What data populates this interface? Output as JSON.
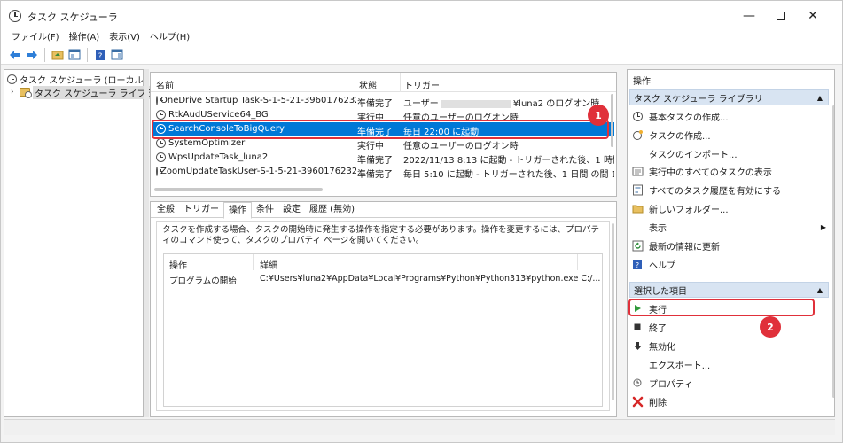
{
  "window": {
    "title": "タスク スケジューラ",
    "minimize": "—",
    "close": "✕"
  },
  "menu": [
    {
      "label": "ファイル(F)"
    },
    {
      "label": "操作(A)"
    },
    {
      "label": "表示(V)"
    },
    {
      "label": "ヘルプ(H)"
    }
  ],
  "tree": {
    "root": "タスク スケジューラ (ローカル)",
    "child": "タスク スケジューラ ライブラリ",
    "child_chevron": "›"
  },
  "task_list": {
    "columns": {
      "name": "名前",
      "status": "状態",
      "trigger": "トリガー"
    },
    "rows": [
      {
        "name": "OneDrive Startup Task-S-1-5-21-3960176232...",
        "status": "準備完了",
        "trigger_prefix": "ユーザー",
        "trigger": "¥luna2 のログオン時"
      },
      {
        "name": "RtkAudUService64_BG",
        "status": "実行中",
        "trigger": "任意のユーザーのログオン時"
      },
      {
        "name": "SearchConsoleToBigQuery",
        "status": "準備完了",
        "trigger": "毎日 22:00 に起動"
      },
      {
        "name": "SystemOptimizer",
        "status": "実行中",
        "trigger": "任意のユーザーのログオン時"
      },
      {
        "name": "WpsUpdateTask_luna2",
        "status": "準備完了",
        "trigger": "2022/11/13 8:13 に起動 - トリガーされた後、1 時間 ごと"
      },
      {
        "name": "ZoomUpdateTaskUser-S-1-5-21-3960176232...",
        "status": "準備完了",
        "trigger": "毎日 5:10 に起動 - トリガーされた後、1 日間 の間 12:00"
      }
    ]
  },
  "detail": {
    "tabs": [
      "全般",
      "トリガー",
      "操作",
      "条件",
      "設定",
      "履歴 (無効)"
    ],
    "active_tab": "操作",
    "description": "タスクを作成する場合、タスクの開始時に発生する操作を指定する必要があります。操作を変更するには、プロパティのコマンド使って、タスクのプロパティ ページを開いてください。",
    "table": {
      "col_action": "操作",
      "col_detail": "詳細",
      "row": {
        "action": "プログラムの開始",
        "detail": "C:¥Users¥luna2¥AppData¥Local¥Programs¥Python¥Python313¥python.exe C:/..."
      }
    }
  },
  "actions_pane": {
    "title": "操作",
    "section1": {
      "title": "タスク スケジューラ ライブラリ",
      "items": [
        {
          "label": "基本タスクの作成...",
          "icon": "create-basic-task-icon"
        },
        {
          "label": "タスクの作成...",
          "icon": "create-task-icon"
        },
        {
          "label": "タスクのインポート...",
          "icon": ""
        },
        {
          "label": "実行中のすべてのタスクの表示",
          "icon": "running-tasks-icon"
        },
        {
          "label": "すべてのタスク履歴を有効にする",
          "icon": "history-icon"
        },
        {
          "label": "新しいフォルダー...",
          "icon": "new-folder-icon"
        },
        {
          "label": "表示",
          "icon": ""
        },
        {
          "label": "最新の情報に更新",
          "icon": "refresh-icon"
        },
        {
          "label": "ヘルプ",
          "icon": "help-icon"
        }
      ]
    },
    "section2": {
      "title": "選択した項目",
      "items": [
        {
          "label": "実行",
          "icon": "run-icon"
        },
        {
          "label": "終了",
          "icon": "end-icon"
        },
        {
          "label": "無効化",
          "icon": "disable-icon"
        },
        {
          "label": "エクスポート...",
          "icon": ""
        },
        {
          "label": "プロパティ",
          "icon": "properties-icon"
        },
        {
          "label": "削除",
          "icon": "delete-icon"
        }
      ]
    }
  },
  "annotations": {
    "badge1": "1",
    "badge2": "2"
  },
  "colors": {
    "selection": "#0078d7",
    "highlight": "#e0303a",
    "section_header": "#d8e4f2"
  }
}
